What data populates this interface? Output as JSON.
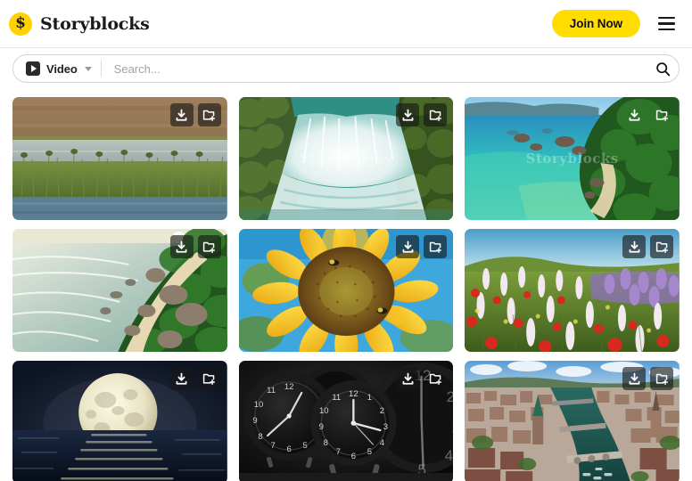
{
  "header": {
    "brand_name": "Storyblocks",
    "logo_glyph": "$",
    "logo_color": "#ffd200",
    "join_label": "Join Now",
    "join_color": "#ffdd00",
    "menu_icon": "hamburger-menu-icon"
  },
  "search": {
    "type_label": "Video",
    "type_icon": "play-icon",
    "caret_icon": "chevron-down-icon",
    "placeholder": "Search...",
    "value": "",
    "submit_icon": "search-icon"
  },
  "actions": {
    "download_label": "Download",
    "download_icon": "download-icon",
    "collection_label": "Add to collection",
    "collection_icon": "folder-plus-icon"
  },
  "results": {
    "watermark_text": "Storyblocks",
    "items": [
      {
        "id": "r1c1",
        "alt": "Wetland marsh with green reeds beside a calm river",
        "buttons_style": "dark"
      },
      {
        "id": "r1c2",
        "alt": "Aerial view of rushing turquoise waterfall in forest",
        "buttons_style": "dark",
        "watermark": true
      },
      {
        "id": "r1c3",
        "alt": "Tropical coastline with turquoise sea and rocky jungle shore",
        "buttons_style": "plain",
        "watermark": true
      },
      {
        "id": "r2c1",
        "alt": "Beach with granite boulders and palm trees at sunset",
        "buttons_style": "dark"
      },
      {
        "id": "r2c2",
        "alt": "Close-up of a yellow sunflower with bees against blue sky",
        "buttons_style": "dark"
      },
      {
        "id": "r2c3",
        "alt": "Wildflower meadow with red poppies and purple lupines",
        "buttons_style": "dark"
      },
      {
        "id": "r3c1",
        "alt": "Full moon rising over a dark ocean at night",
        "buttons_style": "dark"
      },
      {
        "id": "r3c2",
        "alt": "Black and white vintage alarm clocks",
        "buttons_style": "plain"
      },
      {
        "id": "r3c3",
        "alt": "Aerial view of a European old town with a river and bridges",
        "buttons_style": "dark"
      }
    ]
  }
}
